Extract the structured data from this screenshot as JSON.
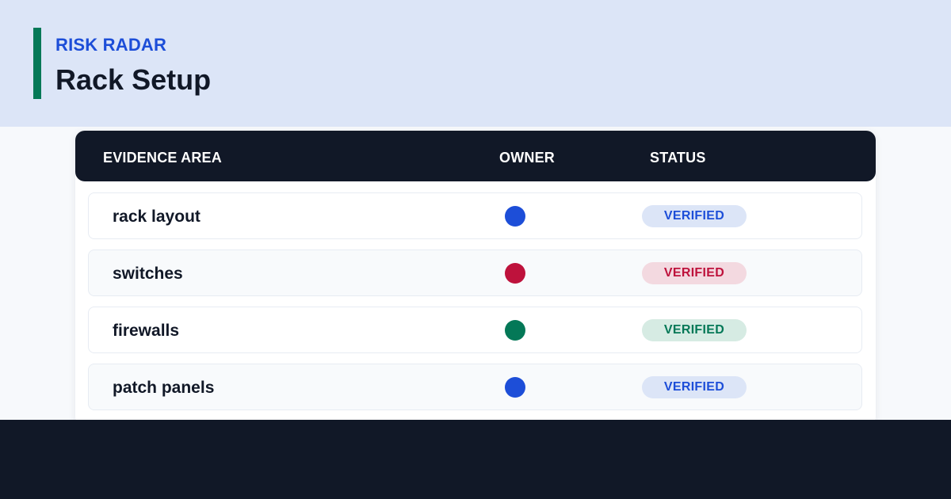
{
  "header": {
    "eyebrow": "RISK RADAR",
    "title": "Rack Setup",
    "accent_color": "#047857",
    "eyebrow_color": "#1d4ed8"
  },
  "table": {
    "columns": [
      "EVIDENCE AREA",
      "OWNER",
      "STATUS"
    ],
    "rows": [
      {
        "area": "rack layout",
        "owner_color": "#1d4ed8",
        "status": "VERIFIED",
        "status_color": "#1d4ed8",
        "status_bg": "#dce5f7"
      },
      {
        "area": "switches",
        "owner_color": "#be123c",
        "status": "VERIFIED",
        "status_color": "#be123c",
        "status_bg": "#f3d9e0"
      },
      {
        "area": "firewalls",
        "owner_color": "#047857",
        "status": "VERIFIED",
        "status_color": "#047857",
        "status_bg": "#d6ebe3"
      },
      {
        "area": "patch panels",
        "owner_color": "#1d4ed8",
        "status": "VERIFIED",
        "status_color": "#1d4ed8",
        "status_bg": "#dce5f7"
      }
    ]
  },
  "theme": {
    "header_bg": "#dce5f7",
    "table_header_bg": "#111827",
    "footer_bg": "#111827"
  }
}
